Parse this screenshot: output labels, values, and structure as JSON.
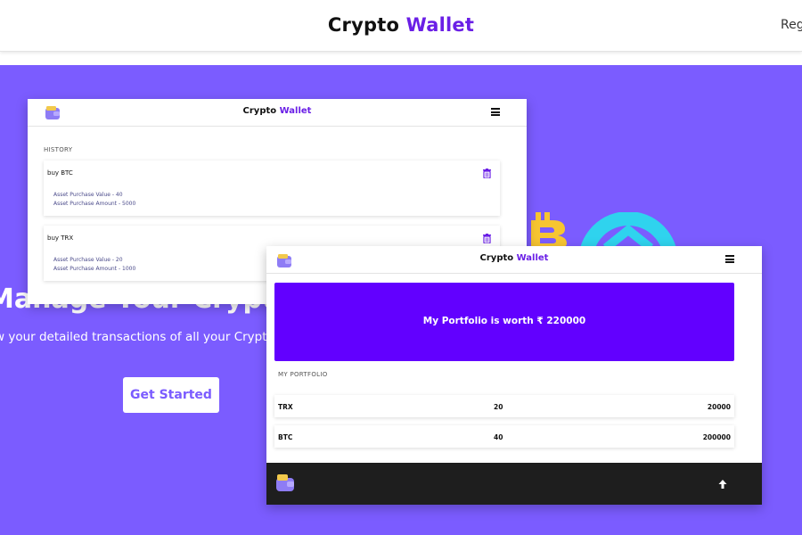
{
  "site": {
    "title_main": "Crypto",
    "title_accent": "Wallet",
    "nav_link": "Reg"
  },
  "hero": {
    "heading": "Manage Your Crypto Wallet",
    "subtitle": "w your detailed transactions of all your Crypto",
    "cta": "Get Started"
  },
  "history_screen": {
    "title_main": "Crypto",
    "title_accent": "Wallet",
    "section": "HISTORY",
    "entries": [
      {
        "title": "buy BTC",
        "value_line": "Asset Purchase Value - 40",
        "amount_line": "Asset Purchase Amount - 5000"
      },
      {
        "title": "buy TRX",
        "value_line": "Asset Purchase Value - 20",
        "amount_line": "Asset Purchase Amount - 1000"
      }
    ]
  },
  "portfolio_screen": {
    "title_main": "Crypto",
    "title_accent": "Wallet",
    "banner": "My Portfolio is worth ₹ 220000",
    "section": "MY PORTFOLIO",
    "holdings": [
      {
        "symbol": "TRX",
        "quantity": "20",
        "value": "20000"
      },
      {
        "symbol": "BTC",
        "quantity": "40",
        "value": "200000"
      }
    ]
  },
  "colors": {
    "brand": "#6a1fe6",
    "hero_bg": "#7b5cff",
    "banner": "#6200ff",
    "footer": "#1e1e1e"
  },
  "icons": [
    "wallet-logo-icon",
    "menu-icon",
    "trash-icon",
    "scroll-top-arrow-icon",
    "bitcoin-icon",
    "coin-icon"
  ]
}
